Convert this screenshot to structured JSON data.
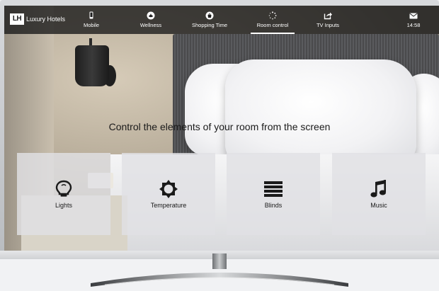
{
  "brand": {
    "logo_mark": "LH",
    "name": "Luxury Hotels"
  },
  "nav": {
    "items": [
      {
        "label": "Mobile",
        "icon": "phone-icon",
        "active": false
      },
      {
        "label": "Wellness",
        "icon": "spa-icon",
        "active": false
      },
      {
        "label": "Shopping Time",
        "icon": "shopping-bag-icon",
        "active": false
      },
      {
        "label": "Room control",
        "icon": "loading-dots-icon",
        "active": true
      },
      {
        "label": "TV Inputs",
        "icon": "share-icon",
        "active": false
      }
    ],
    "clock": {
      "time": "14:58",
      "icon": "envelope-icon"
    }
  },
  "main": {
    "headline": "Control the elements of your room from the screen",
    "tiles": [
      {
        "label": "Lights",
        "icon": "lightbulb-icon"
      },
      {
        "label": "Temperature",
        "icon": "sun-icon"
      },
      {
        "label": "Blinds",
        "icon": "blinds-icon"
      },
      {
        "label": "Music",
        "icon": "music-note-icon"
      }
    ]
  },
  "colors": {
    "topbar": "#1c1c1c",
    "tile": "#e1e1e4",
    "text": "#1a1a1a"
  }
}
